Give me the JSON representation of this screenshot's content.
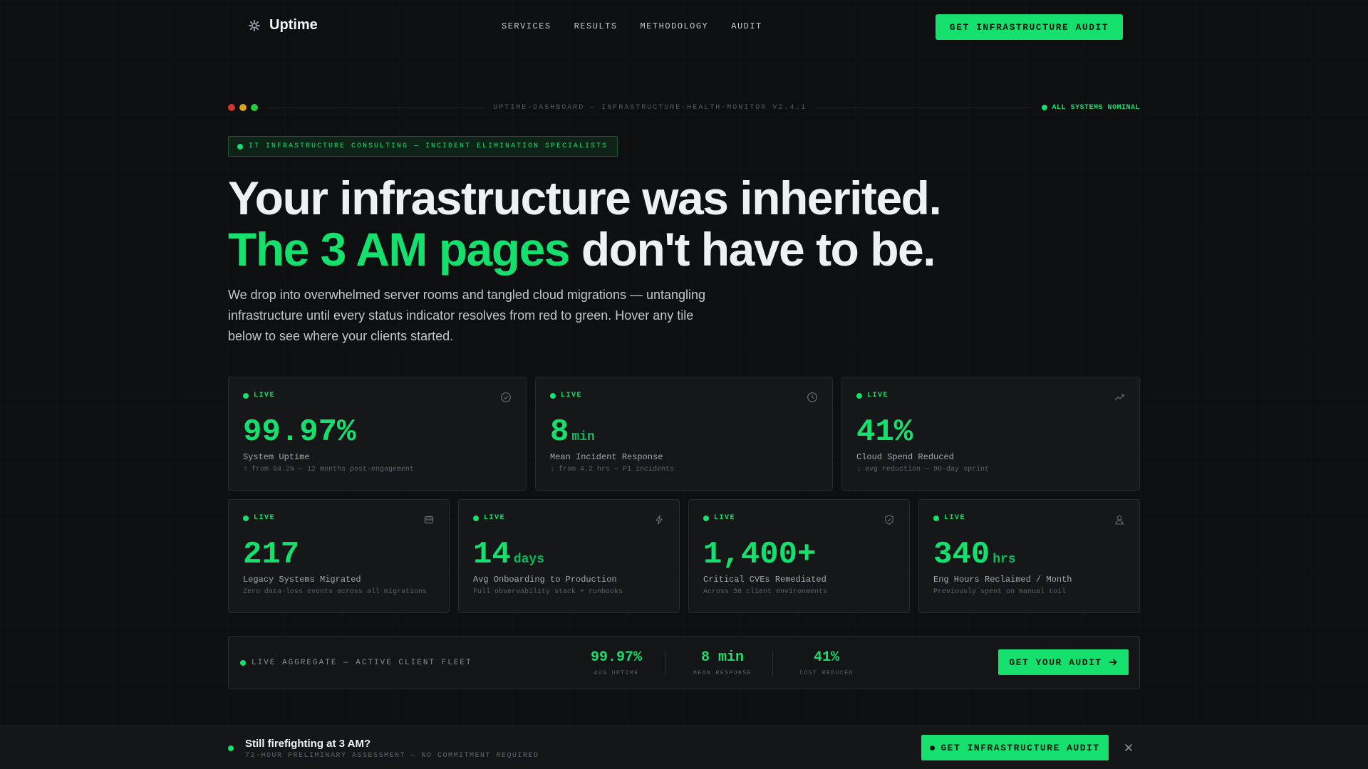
{
  "brand": {
    "name": "Uptime",
    "icon": "gear-icon"
  },
  "nav": {
    "items": [
      "SERVICES",
      "RESULTS",
      "METHODOLOGY",
      "AUDIT"
    ]
  },
  "header": {
    "cta": "GET INFRASTRUCTURE AUDIT"
  },
  "terminal": {
    "title": "UPTIME-DASHBOARD — INFRASTRUCTURE-HEALTH-MONITOR V2.4.1",
    "status": "ALL SYSTEMS NOMINAL"
  },
  "hero": {
    "badge": "IT INFRASTRUCTURE CONSULTING — INCIDENT ELIMINATION SPECIALISTS",
    "headline_line1": "Your infrastructure was inherited.",
    "headline_green": "The 3 AM pages",
    "headline_rest": " don't have to be.",
    "lede": "We drop into overwhelmed server rooms and tangled cloud migrations — untangling infrastructure until every status indicator resolves from red to green. Hover any tile below to see where your clients started."
  },
  "cards_top": [
    {
      "live": "LIVE",
      "icon": "check-circle-icon",
      "value": "99.97%",
      "unit": "",
      "label": "System Uptime",
      "sub": "↑ from 94.2% — 12 months post-engagement"
    },
    {
      "live": "LIVE",
      "icon": "clock-icon",
      "value": "8",
      "unit": "min",
      "label": "Mean Incident Response",
      "sub": "↓ from 4.2 hrs — P1 incidents"
    },
    {
      "live": "LIVE",
      "icon": "trend-up-icon",
      "value": "41%",
      "unit": "",
      "label": "Cloud Spend Reduced",
      "sub": "↓ avg reduction — 90-day sprint"
    }
  ],
  "cards_bottom": [
    {
      "live": "LIVE",
      "icon": "database-icon",
      "value": "217",
      "unit": "",
      "label": "Legacy Systems Migrated",
      "sub": "Zero data-loss events across all migrations"
    },
    {
      "live": "LIVE",
      "icon": "bolt-icon",
      "value": "14",
      "unit": "days",
      "label": "Avg Onboarding to Production",
      "sub": "Full observability stack + runbooks"
    },
    {
      "live": "LIVE",
      "icon": "shield-icon",
      "value": "1,400+",
      "unit": "",
      "label": "Critical CVEs Remediated",
      "sub": "Across 38 client environments"
    },
    {
      "live": "LIVE",
      "icon": "user-icon",
      "value": "340",
      "unit": "hrs",
      "label": "Eng Hours Reclaimed / Month",
      "sub": "Previously spent on manual toil"
    }
  ],
  "aggregate": {
    "label": "LIVE AGGREGATE — ACTIVE CLIENT FLEET",
    "stats": [
      {
        "value": "99.97%",
        "label": "AVG UPTIME"
      },
      {
        "value": "8 min",
        "label": "MEAN RESPONSE"
      },
      {
        "value": "41%",
        "label": "COST REDUCED"
      }
    ],
    "cta": "GET YOUR AUDIT"
  },
  "banner": {
    "title": "Still firefighting at 3 AM?",
    "sub": "72-HOUR PRELIMINARY ASSESSMENT — NO COMMITMENT REQUIRED",
    "cta": "GET INFRASTRUCTURE AUDIT"
  },
  "colors": {
    "accent": "#15e06e",
    "dot_red": "#d0342c",
    "dot_amber": "#d9a21b",
    "dot_green": "#27c93f"
  }
}
